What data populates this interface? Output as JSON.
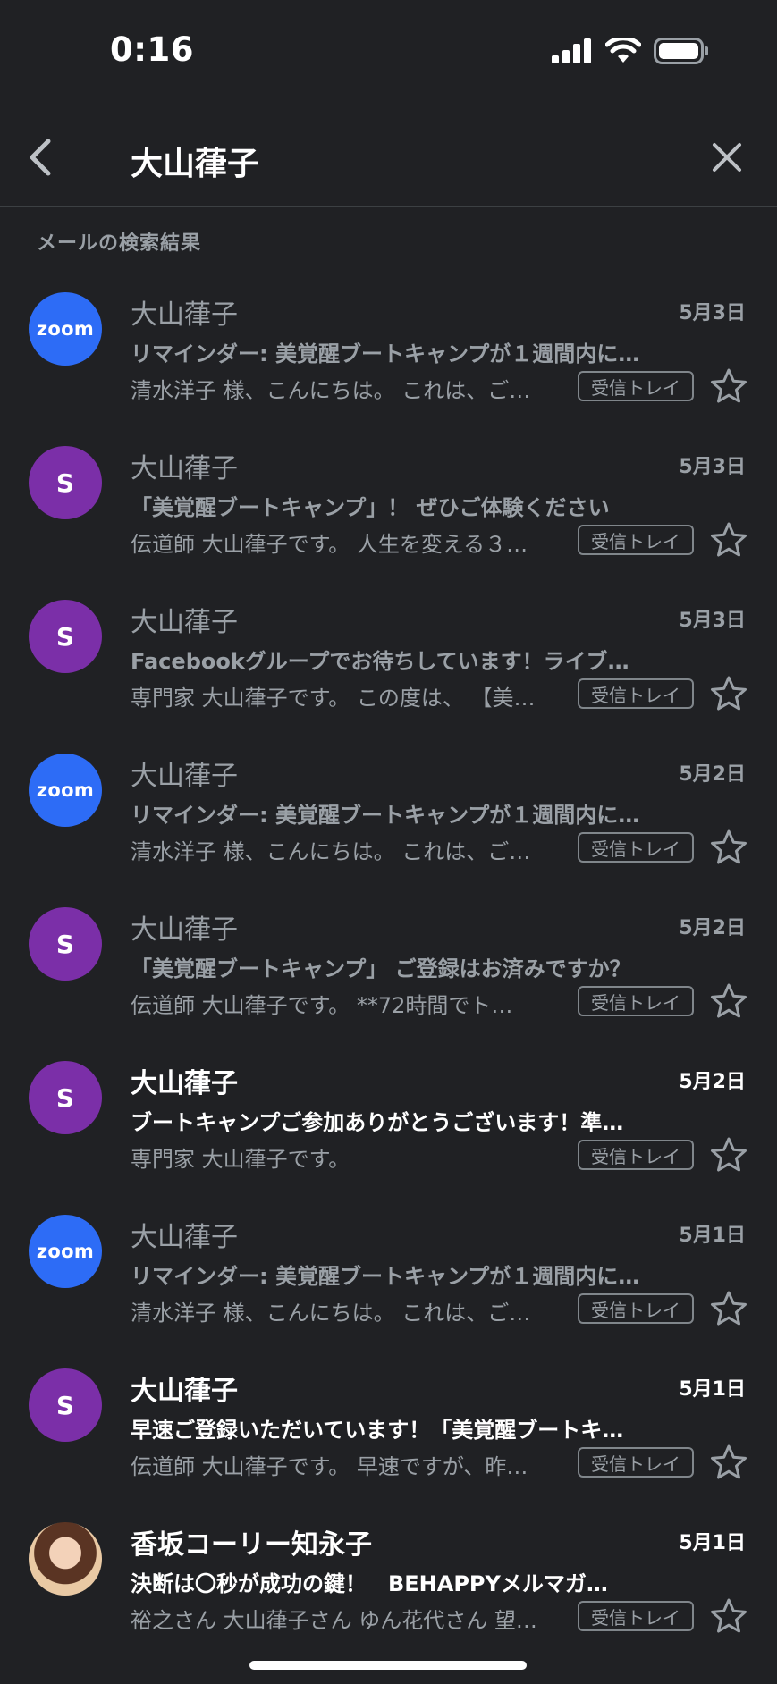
{
  "status_bar": {
    "time": "0:16"
  },
  "search": {
    "query": "大山葎子"
  },
  "results_label": "メールの検索結果",
  "emails": [
    {
      "avatar_type": "zoom",
      "avatar_text": "zoom",
      "sender": "大山葎子",
      "date": "5月3日",
      "unread": false,
      "subject": "リマインダー: 美覚醒ブートキャンプが１週間内に…",
      "snippet": "清水洋子 様、こんにちは。 これは、ご…",
      "label": "受信トレイ"
    },
    {
      "avatar_type": "s",
      "avatar_text": "S",
      "sender": "大山葎子",
      "date": "5月3日",
      "unread": false,
      "subject": "「美覚醒ブートキャンプ」！ ぜひご体験ください",
      "snippet": "伝道師 大山葎子です。 人生を変える３…",
      "label": "受信トレイ"
    },
    {
      "avatar_type": "s",
      "avatar_text": "S",
      "sender": "大山葎子",
      "date": "5月3日",
      "unread": false,
      "subject": "Facebookグループでお待ちしています！ライブ…",
      "snippet": "専門家 大山葎子です。 この度は、 【美…",
      "label": "受信トレイ"
    },
    {
      "avatar_type": "zoom",
      "avatar_text": "zoom",
      "sender": "大山葎子",
      "date": "5月2日",
      "unread": false,
      "subject": "リマインダー: 美覚醒ブートキャンプが１週間内に…",
      "snippet": "清水洋子 様、こんにちは。 これは、ご…",
      "label": "受信トレイ"
    },
    {
      "avatar_type": "s",
      "avatar_text": "S",
      "sender": "大山葎子",
      "date": "5月2日",
      "unread": false,
      "subject": "「美覚醒ブートキャンプ」 ご登録はお済みですか？",
      "snippet": "伝道師 大山葎子です。 **72時間でト…",
      "label": "受信トレイ"
    },
    {
      "avatar_type": "s",
      "avatar_text": "S",
      "sender": "大山葎子",
      "date": "5月2日",
      "unread": true,
      "subject": "ブートキャンプご参加ありがとうございます！準…",
      "snippet": "専門家 大山葎子です。",
      "label": "受信トレイ"
    },
    {
      "avatar_type": "zoom",
      "avatar_text": "zoom",
      "sender": "大山葎子",
      "date": "5月1日",
      "unread": false,
      "subject": "リマインダー: 美覚醒ブートキャンプが１週間内に…",
      "snippet": "清水洋子 様、こんにちは。 これは、ご…",
      "label": "受信トレイ"
    },
    {
      "avatar_type": "s",
      "avatar_text": "S",
      "sender": "大山葎子",
      "date": "5月1日",
      "unread": true,
      "subject": "早速ご登録いただいています！「美覚醒ブートキ…",
      "snippet": "伝道師 大山葎子です。 早速ですが、昨…",
      "label": "受信トレイ"
    },
    {
      "avatar_type": "photo",
      "avatar_text": "",
      "sender": "香坂コーリー知永子",
      "date": "5月1日",
      "unread": true,
      "subject": "決断は〇秒が成功の鍵！　BEHAPPYメルマガ…",
      "snippet": "裕之さん 大山葎子さん ゆん花代さん 望…",
      "label": "受信トレイ"
    }
  ]
}
